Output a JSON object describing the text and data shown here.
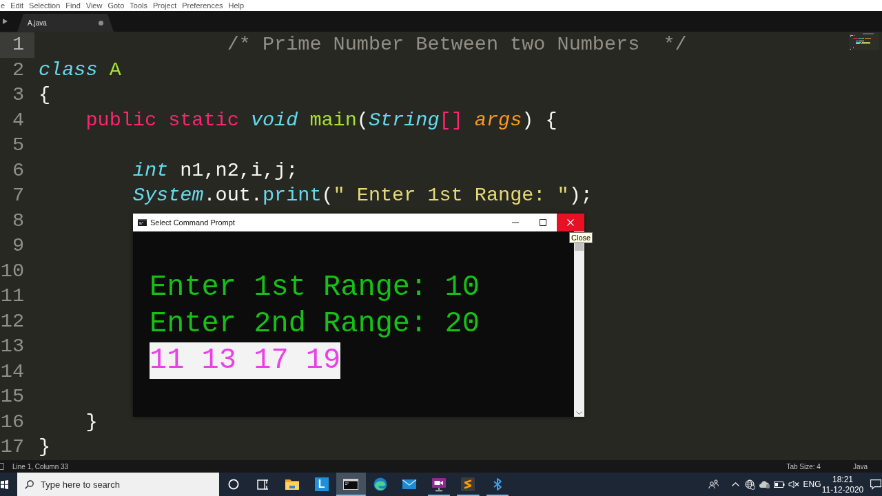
{
  "menu_bar": {
    "items": [
      "e",
      "Edit",
      "Selection",
      "Find",
      "View",
      "Goto",
      "Tools",
      "Project",
      "Preferences",
      "Help"
    ]
  },
  "tab_bar": {
    "tabs": [
      {
        "label": "A.java",
        "selected": true,
        "modified": true
      }
    ]
  },
  "editor": {
    "lines": [
      {
        "number": "1",
        "current": true,
        "tokens": [
          {
            "text": "\t\t\t\t/* Prime Number Between two Numbers  */",
            "kind": "comment"
          }
        ]
      },
      {
        "number": "2",
        "current": false,
        "tokens": [
          {
            "text": "class ",
            "kind": "storage"
          },
          {
            "text": "A",
            "kind": "entity"
          }
        ]
      },
      {
        "number": "3",
        "current": false,
        "tokens": [
          {
            "text": "{",
            "kind": "plain"
          }
        ]
      },
      {
        "number": "4",
        "current": false,
        "tokens": [
          {
            "text": "\tpublic static ",
            "kind": "keyword"
          },
          {
            "text": "void ",
            "kind": "storage"
          },
          {
            "text": "main",
            "kind": "entity"
          },
          {
            "text": "(",
            "kind": "plain"
          },
          {
            "text": "String",
            "kind": "storage"
          },
          {
            "text": "[]",
            "kind": "keyword"
          },
          {
            "text": " args",
            "kind": "parameter"
          },
          {
            "text": ") {",
            "kind": "plain"
          }
        ]
      },
      {
        "number": "5",
        "current": false
      },
      {
        "number": "6",
        "current": false,
        "tokens": [
          {
            "text": "\t\tint",
            "kind": "storage"
          },
          {
            "text": " n1,n2,i,j;",
            "kind": "plain"
          }
        ]
      },
      {
        "number": "7",
        "current": false,
        "tokens": [
          {
            "text": "\t\tSystem",
            "kind": "storage"
          },
          {
            "text": ".out.",
            "kind": "plain"
          },
          {
            "text": "print",
            "kind": "function"
          },
          {
            "text": "(",
            "kind": "plain"
          },
          {
            "text": "\" Enter 1st Range: \"",
            "kind": "string"
          },
          {
            "text": ");",
            "kind": "plain"
          }
        ]
      },
      {
        "number": "8",
        "current": false
      },
      {
        "number": "9",
        "current": false
      },
      {
        "number": "10",
        "current": false
      },
      {
        "number": "11",
        "current": false
      },
      {
        "number": "12",
        "current": false
      },
      {
        "number": "13",
        "current": false
      },
      {
        "number": "14",
        "current": false
      },
      {
        "number": "15",
        "current": false
      },
      {
        "number": "16",
        "current": false,
        "tokens": [
          {
            "text": "\t}",
            "kind": "plain"
          }
        ]
      },
      {
        "number": "17",
        "current": false,
        "tokens": [
          {
            "text": "}",
            "kind": "plain"
          }
        ]
      }
    ]
  },
  "console_window": {
    "title": "Select Command Prompt",
    "close_hovered": true,
    "tooltip": "Close",
    "lines": [
      {
        "text": "Enter 1st Range: 10",
        "selected": false
      },
      {
        "text": "Enter 2nd Range: 20",
        "selected": false
      },
      {
        "text": "11 13 17 19",
        "selected": true
      }
    ]
  },
  "status_bar": {
    "cursor": "Line 1, Column 33",
    "tab_size": "Tab Size: 4",
    "syntax": "Java"
  },
  "taskbar": {
    "search": {
      "placeholder": "Type here to search"
    },
    "buttons": [
      {
        "kind": "cortana",
        "running": false,
        "selected": false
      },
      {
        "kind": "task-view",
        "running": false,
        "selected": false
      },
      {
        "kind": "folder",
        "running": false,
        "selected": false
      },
      {
        "kind": "letter-tile",
        "label": "L",
        "running": false,
        "selected": false
      },
      {
        "kind": "terminal",
        "running": true,
        "selected": true
      },
      {
        "kind": "swirl",
        "running": false,
        "selected": false
      },
      {
        "kind": "mail",
        "running": false,
        "selected": false
      },
      {
        "kind": "video",
        "running": true,
        "selected": false
      },
      {
        "kind": "sublime",
        "running": true,
        "selected": false
      },
      {
        "kind": "bluetooth",
        "running": true,
        "selected": false
      }
    ],
    "tray": {
      "language": "ENG",
      "time": "18:21",
      "date": "11-12-2020"
    }
  }
}
